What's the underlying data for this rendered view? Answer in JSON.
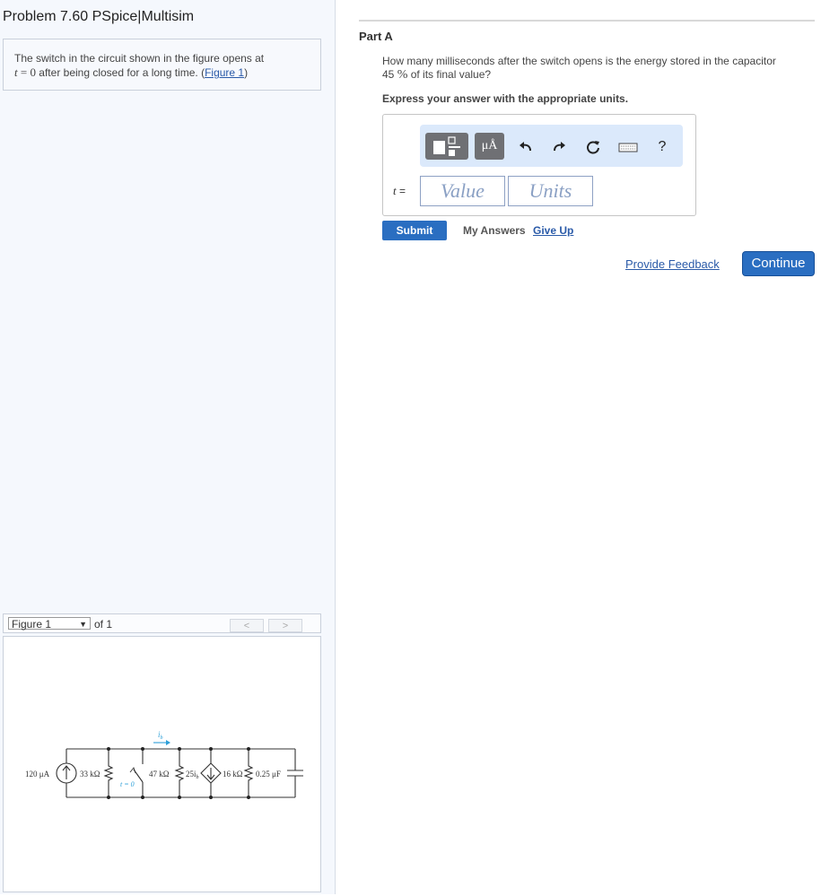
{
  "problem": {
    "title": "Problem 7.60 PSpice|Multisim",
    "intro_part1": "The switch in the circuit shown in the figure opens at",
    "intro_t": "t",
    "intro_eq": " = 0",
    "intro_part2": " after being closed for a long time. (",
    "figure_link": "Figure 1",
    "intro_close": ")"
  },
  "figure_nav": {
    "select_value": "Figure 1",
    "of_label": "of 1",
    "prev": "<",
    "next": ">"
  },
  "circuit": {
    "source_label": "120 μA",
    "r1_label": "33 kΩ",
    "switch_label": "t = 0",
    "r2_label": "47 kΩ",
    "current_label": "i",
    "current_sub": "b",
    "dep_label": "25i",
    "dep_sub": "b",
    "r3_label": "16 kΩ",
    "cap_label": "0.25 μF"
  },
  "part_a": {
    "title": "Part A",
    "question_1": "How many milliseconds after the switch opens is the energy stored in the capacitor",
    "question_2a": "45 ",
    "question_pct": "%",
    "question_2b": " of its final value?",
    "instruction": "Express your answer with the appropriate units.",
    "mu_button": "μÅ",
    "help_button": "?",
    "t_var": "t",
    "t_eq": " =",
    "value_placeholder": "Value",
    "units_placeholder": "Units",
    "submit": "Submit",
    "my_answers": "My Answers",
    "give_up": "Give Up"
  },
  "footer": {
    "feedback": "Provide Feedback",
    "continue": "Continue"
  },
  "colors": {
    "accent": "#2a6ec1",
    "link": "#2a5aa8",
    "toolbar_bg": "#dbe9fb",
    "current_arrow": "#2d9fd8"
  },
  "icons": [
    "template-icon",
    "undo-icon",
    "redo-icon",
    "reset-icon",
    "keyboard-icon",
    "help-icon"
  ]
}
